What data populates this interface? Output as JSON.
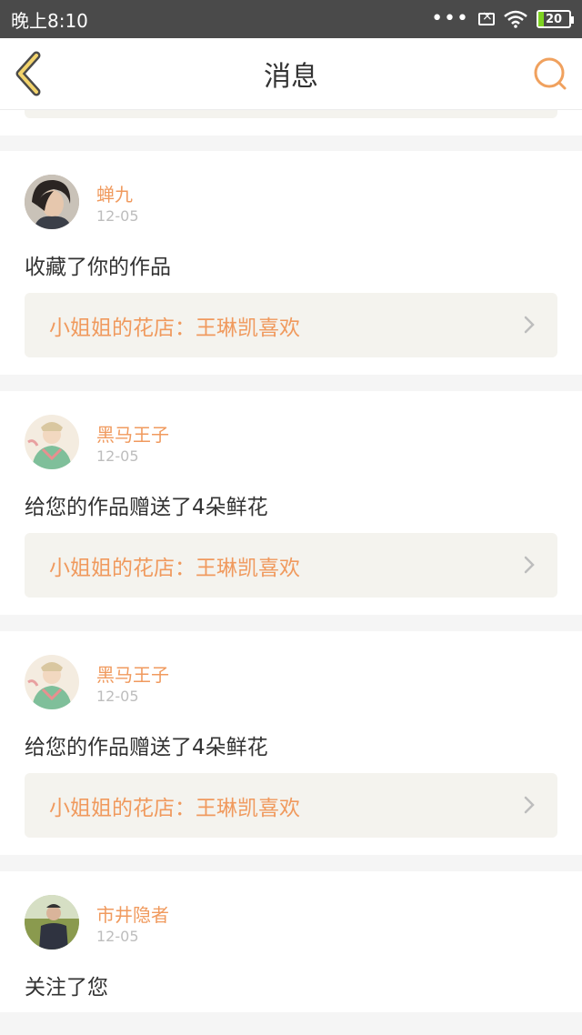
{
  "status": {
    "time": "晚上8:10",
    "dots": "•••",
    "battery": "20",
    "battery_color": "#7ed321"
  },
  "nav": {
    "title": "消息",
    "back_icon": "back-chevron-icon",
    "search_icon": "search-icon",
    "accent": "#f0a15e"
  },
  "messages": [
    {
      "username": "蝉九",
      "date": "12-05",
      "action": "收藏了你的作品",
      "work": "小姐姐的花店：王琳凯喜欢"
    },
    {
      "username": "黑马王子",
      "date": "12-05",
      "action": "给您的作品赠送了4朵鲜花",
      "work": "小姐姐的花店：王琳凯喜欢"
    },
    {
      "username": "黑马王子",
      "date": "12-05",
      "action": "给您的作品赠送了4朵鲜花",
      "work": "小姐姐的花店：王琳凯喜欢"
    },
    {
      "username": "市井隐者",
      "date": "12-05",
      "action": "关注了您"
    }
  ]
}
